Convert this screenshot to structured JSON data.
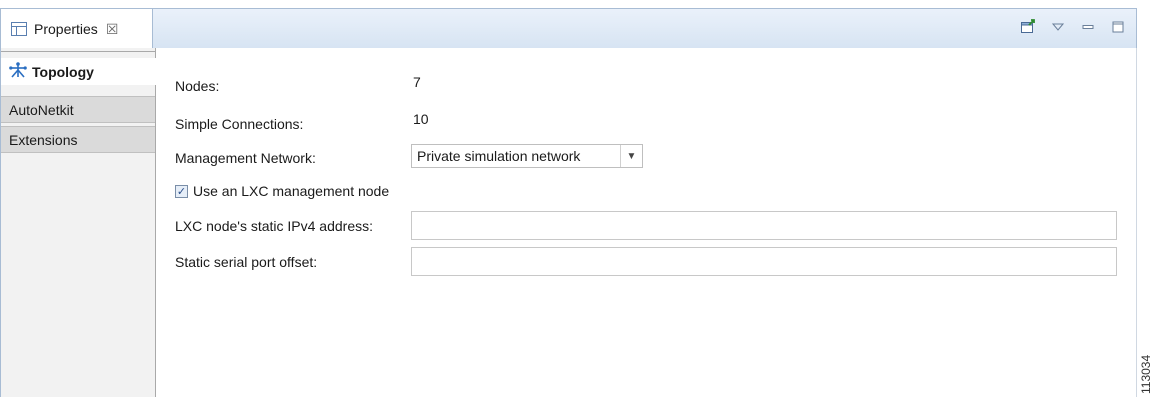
{
  "tab": {
    "title": "Properties",
    "close_glyph": "☒"
  },
  "toolbar": {
    "icons": [
      "new-window-icon",
      "view-menu-icon",
      "minimize-icon",
      "maximize-icon"
    ]
  },
  "sidebar": {
    "items": [
      {
        "label": "Topology",
        "icon": "topology-icon",
        "active": true
      },
      {
        "label": "AutoNetkit",
        "active": false
      },
      {
        "label": "Extensions",
        "active": false
      }
    ]
  },
  "form": {
    "nodes_label": "Nodes:",
    "nodes_value": "7",
    "connections_label": "Simple Connections:",
    "connections_value": "10",
    "mgmt_label": "Management Network:",
    "mgmt_value": "Private simulation network",
    "lxc_checkbox_label": "Use an LXC management node",
    "lxc_checked": true,
    "ipv4_label": "LXC node's static IPv4 address:",
    "ipv4_value": "",
    "serial_label": "Static serial port offset:",
    "serial_value": ""
  },
  "figure_id": "113034",
  "colors": {
    "accent": "#2a6ec1",
    "titlebar": "#dde8f5"
  }
}
